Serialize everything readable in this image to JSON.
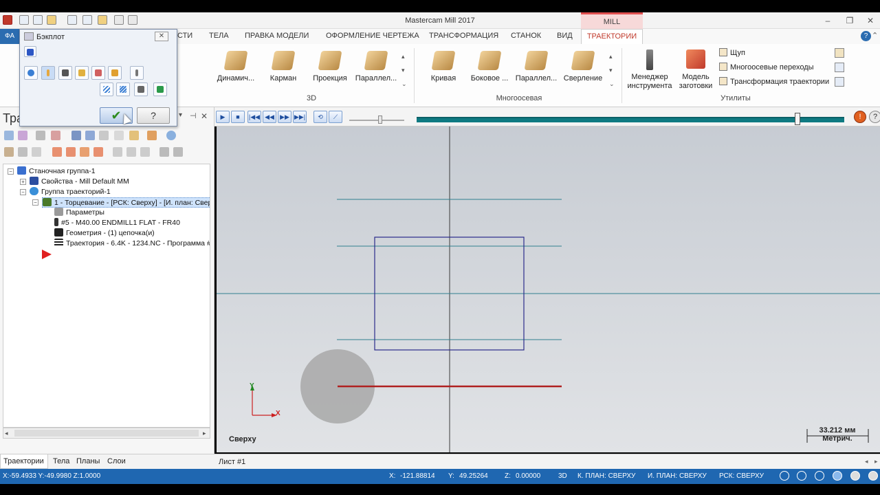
{
  "app": {
    "title": "Mastercam Mill 2017",
    "context_tab": "MILL",
    "window_buttons": [
      "–",
      "❐",
      "✕"
    ]
  },
  "ribbon_tabs": {
    "file": "ФА",
    "items": [
      "СТИ",
      "ТЕЛА",
      "ПРАВКА МОДЕЛИ",
      "ОФОРМЛЕНИЕ ЧЕРТЕЖА",
      "ТРАНСФОРМАЦИЯ",
      "СТАНОК",
      "ВИД"
    ],
    "active": "ТРАЕКТОРИИ"
  },
  "ribbon": {
    "group_3d": {
      "label": "3D",
      "buttons": [
        "Динамич...",
        "Карман",
        "Проекция",
        "Параллел..."
      ]
    },
    "group_multiaxis": {
      "label": "Многоосевая",
      "buttons": [
        "Кривая",
        "Боковое ...",
        "Параллел...",
        "Сверление"
      ]
    },
    "group_utils": {
      "label": "Утилиты",
      "tool_manager": [
        "Менеджер",
        "инструмента"
      ],
      "stock_model": [
        "Модель",
        "заготовки"
      ],
      "rows": [
        "Щуп",
        "Многоосевые переходы",
        "Трансформация траектории"
      ]
    }
  },
  "backplot": {
    "title": "Бэкплот",
    "close": "✕",
    "ok": "✔",
    "help": "?"
  },
  "left_panel": {
    "title": "Тра",
    "pin": "⊣",
    "close": "✕",
    "tree": [
      "Станочная группа-1",
      "Свойства - Mill Default MM",
      "Группа траекторий-1",
      "1 - Торцевание - [РСК: Сверху] - [И. план: Свер",
      "Параметры",
      "#5 - M40.00 ENDMILL1 FLAT - FR40",
      "Геометрия -  (1) цепочка(и)",
      "Траектория - 6.4K - 1234.NC - Программа #"
    ],
    "bottom_tabs": [
      "Траектории",
      "Тела",
      "Планы",
      "Слои"
    ]
  },
  "viewport": {
    "view_name": "Сверху",
    "axis_x": "X",
    "axis_y": "Y",
    "scale_value": "33.212 мм",
    "scale_unit": "Метрич.",
    "colors": {
      "rect": "#2a2a8a",
      "pass": "#2f7f8f",
      "active_pass": "#b02020",
      "tool": "#a8a8a8"
    }
  },
  "sheet_tab": "Лист #1",
  "statusbar": {
    "cursor": "X:-59.4933  Y:-49.9980  Z:1.0000",
    "x_label": "X:",
    "x_value": "-121.88814",
    "y_label": "Y:",
    "y_value": "49.25264",
    "z_label": "Z:",
    "z_value": "0.00000",
    "mode": "3D",
    "k_plan": "К. ПЛАН: СВЕРХУ",
    "i_plan": "И. ПЛАН: СВЕРХУ",
    "rsk": "РСК: СВЕРХУ"
  }
}
